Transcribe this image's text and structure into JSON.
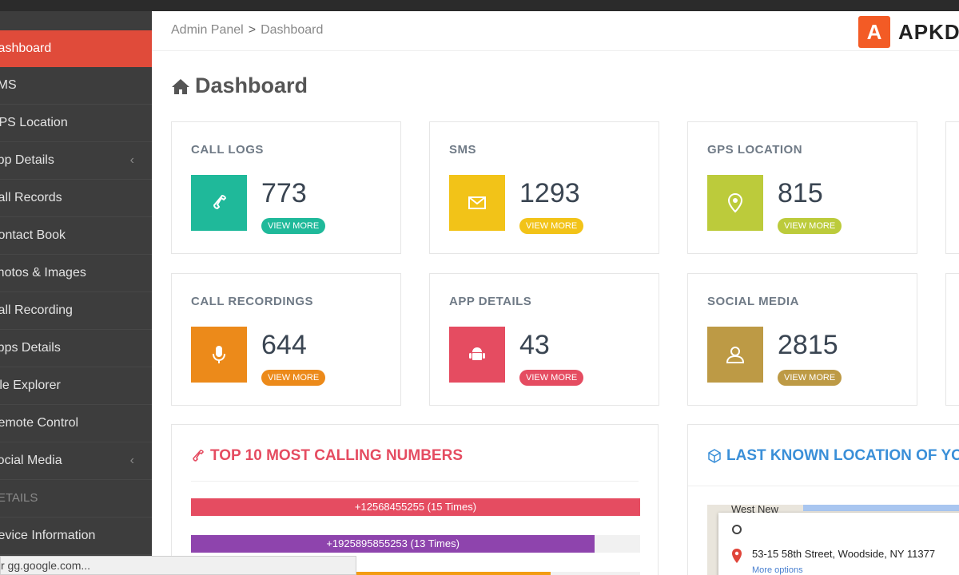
{
  "sidebar": {
    "items": [
      {
        "label": "Dashboard",
        "active": true
      },
      {
        "label": "SMS"
      },
      {
        "label": "GPS Location"
      },
      {
        "label": "App Details",
        "chevron": "‹"
      },
      {
        "label": "Call Records"
      },
      {
        "label": "Contact Book"
      },
      {
        "label": "Photos & Images"
      },
      {
        "label": "Call Recording"
      },
      {
        "label": "Apps Details"
      },
      {
        "label": "File Explorer"
      },
      {
        "label": "Remote Control"
      },
      {
        "label": "Social Media",
        "chevron": "‹"
      },
      {
        "label": "DETAILS",
        "header": true
      },
      {
        "label": "Device Information"
      }
    ]
  },
  "breadcrumb": {
    "root": "Admin Panel",
    "separator": ">",
    "current": "Dashboard"
  },
  "brand": {
    "logo_letter": "A",
    "text": "APKD"
  },
  "page": {
    "title": "Dashboard"
  },
  "cards": [
    {
      "title": "CALL LOGS",
      "value": "773",
      "button": "VIEW MORE",
      "color": "#1fb99a",
      "icon": "phone-icon"
    },
    {
      "title": "SMS",
      "value": "1293",
      "button": "VIEW MORE",
      "color": "#f2c318",
      "icon": "envelope-icon"
    },
    {
      "title": "GPS LOCATION",
      "value": "815",
      "button": "VIEW MORE",
      "color": "#bccb3b",
      "icon": "map-pin-icon"
    },
    {
      "title": "CALL RECORDINGS",
      "value": "644",
      "button": "VIEW MORE",
      "color": "#ec8a1a",
      "icon": "microphone-icon"
    },
    {
      "title": "APP DETAILS",
      "value": "43",
      "button": "VIEW MORE",
      "color": "#e54c61",
      "icon": "android-icon"
    },
    {
      "title": "SOCIAL MEDIA",
      "value": "2815",
      "button": "VIEW MORE",
      "color": "#bd9a45",
      "icon": "users-icon"
    }
  ],
  "calling_panel": {
    "title": "TOP 10 MOST CALLING NUMBERS",
    "title_color": "#e54c61",
    "bars": [
      {
        "label": "+12568455255 (15 Times)",
        "fraction": 1.0,
        "color": "#e54c61"
      },
      {
        "label": "+1925895855253 (13 Times)",
        "fraction": 0.899,
        "color": "#8e44ad"
      },
      {
        "label": "",
        "fraction": 0.8,
        "color": "#f39c12"
      }
    ]
  },
  "location_panel": {
    "title": "LAST KNOWN LOCATION OF YO",
    "title_color": "#3a8fd8",
    "map_label": "West New",
    "address": "53-15 58th Street, Woodside, NY 11377",
    "more_options": "More options"
  },
  "status_tip": "r gg.google.com..."
}
